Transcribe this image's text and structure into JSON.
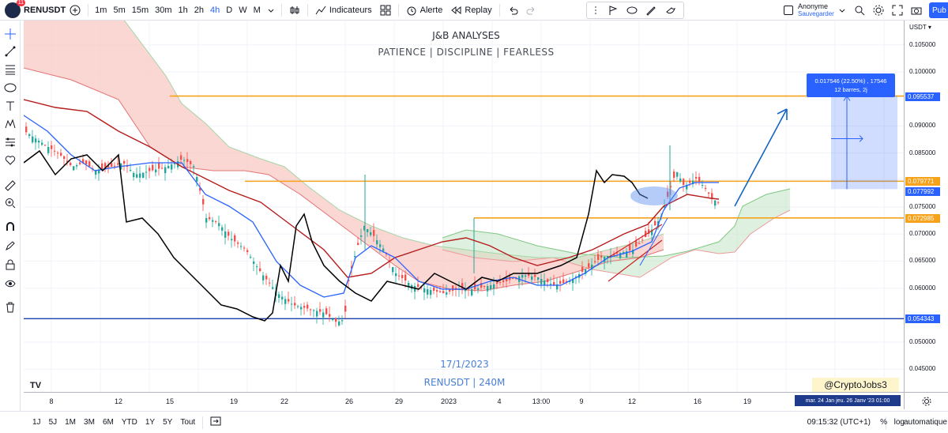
{
  "header": {
    "badge": "11",
    "symbol": "RENUSDT",
    "timeframes": [
      "1m",
      "5m",
      "15m",
      "30m",
      "1h",
      "2h",
      "4h",
      "D",
      "W",
      "M"
    ],
    "active_timeframe": "4h",
    "indicators_label": "Indicateurs",
    "alert_label": "Alerte",
    "replay_label": "Replay",
    "user_name": "Anonyme",
    "user_sub": "Sauvegarder",
    "publish_label": "Pub"
  },
  "overlays": {
    "title": "J&B ANALYSES",
    "subtitle": "PATIENCE  |  DISCIPLINE  |  FEARLESS",
    "date": "17/1/2023",
    "pair": "RENUSDT | 240M",
    "measure_line1": "0.017546 (22.50%) , 17546",
    "measure_line2": "12 barres, 2j",
    "watermark": "@CryptoJobs3",
    "time_tag": "mar. 24 Jan  jeu. 26 Janv '23  01:00"
  },
  "price_axis": {
    "currency": "USDT",
    "labels": [
      "0.105000",
      "0.100000",
      "0.090000",
      "0.085000",
      "0.080000",
      "0.075000",
      "0.070000",
      "0.065000",
      "0.060000",
      "0.050000",
      "0.045000"
    ],
    "tags": [
      {
        "value": "0.095537",
        "color": "#2962ff"
      },
      {
        "value": "0.079771",
        "color": "#f7a21b"
      },
      {
        "value": "0.077992",
        "color": "#2962ff"
      },
      {
        "value": "0.072985",
        "color": "#f7a21b"
      },
      {
        "value": "0.054343",
        "color": "#2962ff"
      }
    ]
  },
  "time_axis": {
    "labels": [
      "8",
      "12",
      "15",
      "19",
      "22",
      "26",
      "29",
      "2023",
      "4",
      "13:00",
      "9",
      "12",
      "16",
      "19"
    ]
  },
  "bottom": {
    "ranges": [
      "1J",
      "5J",
      "1M",
      "3M",
      "6M",
      "YTD",
      "1Y",
      "5Y",
      "Tout"
    ],
    "clock": "09:15:32 (UTC+1)",
    "percent": "%",
    "log": "log",
    "auto": "automatique"
  },
  "colors": {
    "orange_level": "#f7a21b",
    "blue_level": "#2962ff",
    "candle_up": "#26a69a",
    "candle_down": "#ef5350",
    "cloud_red": "#f8c9c4",
    "cloud_green": "#c8e6c9",
    "text_blue": "#4a7fd6"
  }
}
